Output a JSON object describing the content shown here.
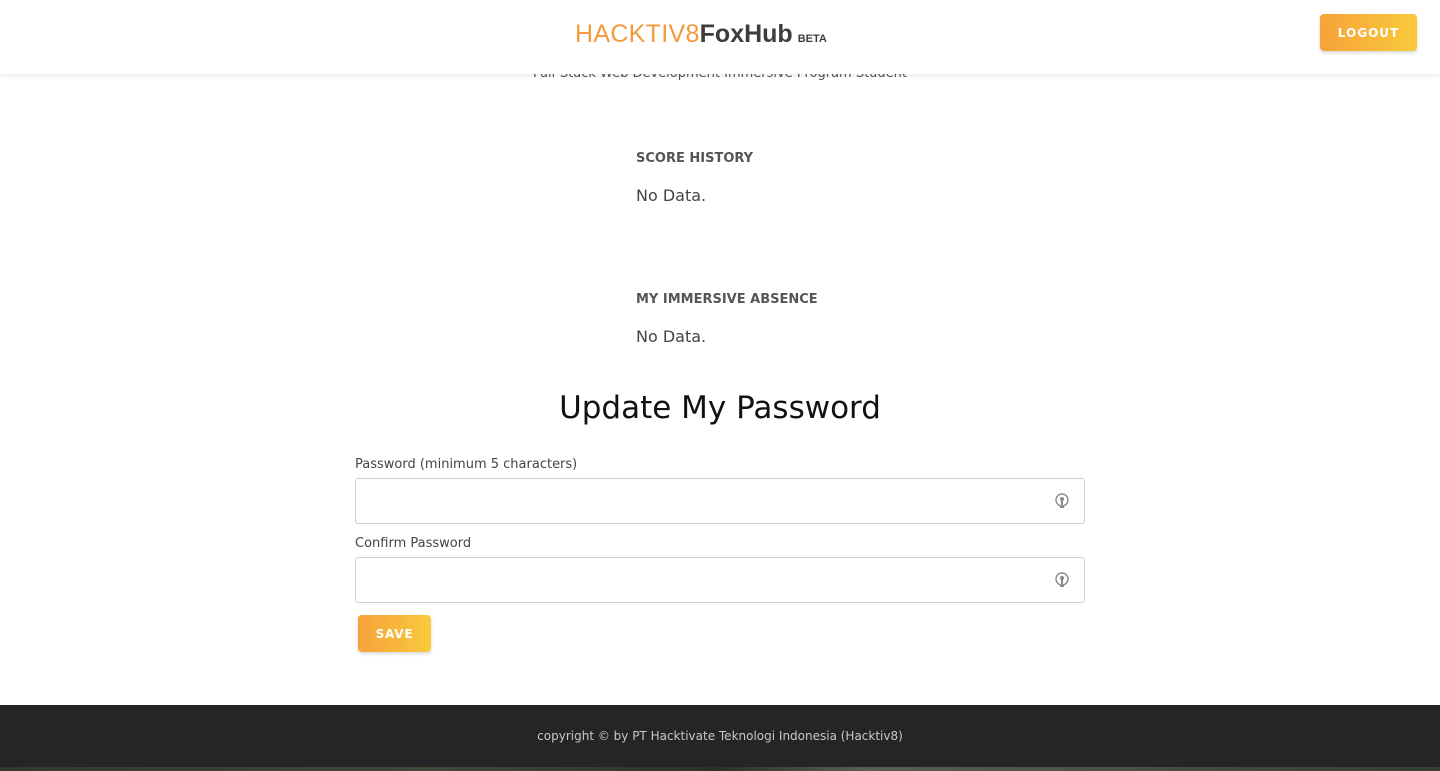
{
  "header": {
    "brand_primary": "HACKTIV8",
    "brand_secondary": "FoxHub",
    "brand_badge": "BETA",
    "logout_label": "LOGOUT"
  },
  "profile": {
    "subtitle": "Full-Stack Web Development Immersive Program Student"
  },
  "score_history": {
    "heading": "SCORE HISTORY",
    "value": "No Data."
  },
  "absence": {
    "heading": "MY IMMERSIVE ABSENCE",
    "value": "No Data."
  },
  "update_password": {
    "title": "Update My Password",
    "password_label": "Password (minimum 5 characters)",
    "password_value": "",
    "confirm_label": "Confirm Password",
    "confirm_value": "",
    "save_label": "SAVE",
    "field_icon": "key-icon"
  },
  "footer": {
    "copyright": "copyright © by PT Hacktivate Teknologi Indonesia (Hacktiv8)"
  },
  "colors": {
    "accent_start": "#f7a23a",
    "accent_end": "#f9ca3c",
    "brand_orange": "#f39a3b",
    "footer_bg": "#252525"
  }
}
